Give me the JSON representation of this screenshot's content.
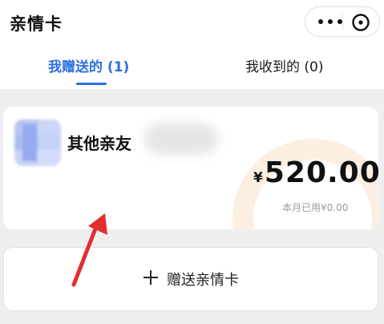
{
  "header": {
    "title": "亲情卡",
    "more_icon": "more-dots-icon",
    "close_icon": "close-circle-icon"
  },
  "tabs": [
    {
      "label": "我赠送的 (1)",
      "active": true
    },
    {
      "label": "我收到的 (0)",
      "active": false
    }
  ],
  "card": {
    "name": "其他亲友",
    "currency": "¥",
    "amount": "520.00",
    "used_text": "本月已用¥0.00"
  },
  "gift_button": {
    "icon": "plus-icon",
    "label": "赠送亲情卡"
  },
  "colors": {
    "accent": "#2b6fe0",
    "annotation_arrow": "#e03030"
  }
}
